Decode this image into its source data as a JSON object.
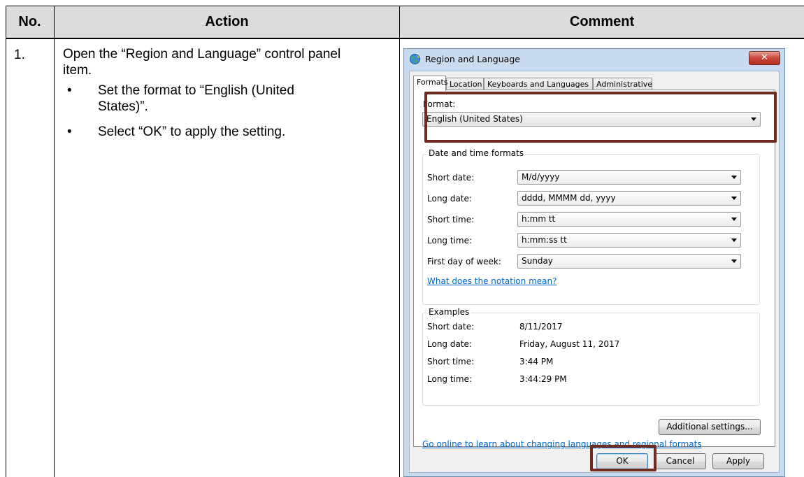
{
  "table": {
    "headers": {
      "no": "No.",
      "action": "Action",
      "comment": "Comment"
    },
    "row": {
      "number": "1.",
      "intro": "Open the “Region and Language” control panel item.",
      "bullets": [
        "Set the format to “English (United States)”.",
        "Select “OK” to apply the setting."
      ],
      "bullet_glyph": "•"
    }
  },
  "dialog": {
    "title": "Region and Language",
    "close_glyph": "✕",
    "tabs": [
      "Formats",
      "Location",
      "Keyboards and Languages",
      "Administrative"
    ],
    "active_tab": "Formats",
    "format": {
      "label": "Format:",
      "value": "English (United States)"
    },
    "date_time": {
      "title": "Date and time formats",
      "rows": [
        {
          "label": "Short date:",
          "value": "M/d/yyyy"
        },
        {
          "label": "Long date:",
          "value": "dddd, MMMM dd, yyyy"
        },
        {
          "label": "Short time:",
          "value": "h:mm tt"
        },
        {
          "label": "Long time:",
          "value": "h:mm:ss tt"
        },
        {
          "label": "First day of week:",
          "value": "Sunday"
        }
      ],
      "notation_link": "What does the notation mean?"
    },
    "examples": {
      "title": "Examples",
      "rows": [
        {
          "label": "Short date:",
          "value": "8/11/2017"
        },
        {
          "label": "Long date:",
          "value": "Friday, August 11, 2017"
        },
        {
          "label": "Short time:",
          "value": "3:44 PM"
        },
        {
          "label": "Long time:",
          "value": "3:44:29 PM"
        }
      ]
    },
    "additional_settings": "Additional settings...",
    "online_link": "Go online to learn about changing languages and regional formats",
    "buttons": {
      "ok": "OK",
      "cancel": "Cancel",
      "apply": "Apply"
    }
  },
  "colors": {
    "highlight": "#6e2b1e",
    "header_bg": "#dcdcdc",
    "link": "#0066cc"
  }
}
